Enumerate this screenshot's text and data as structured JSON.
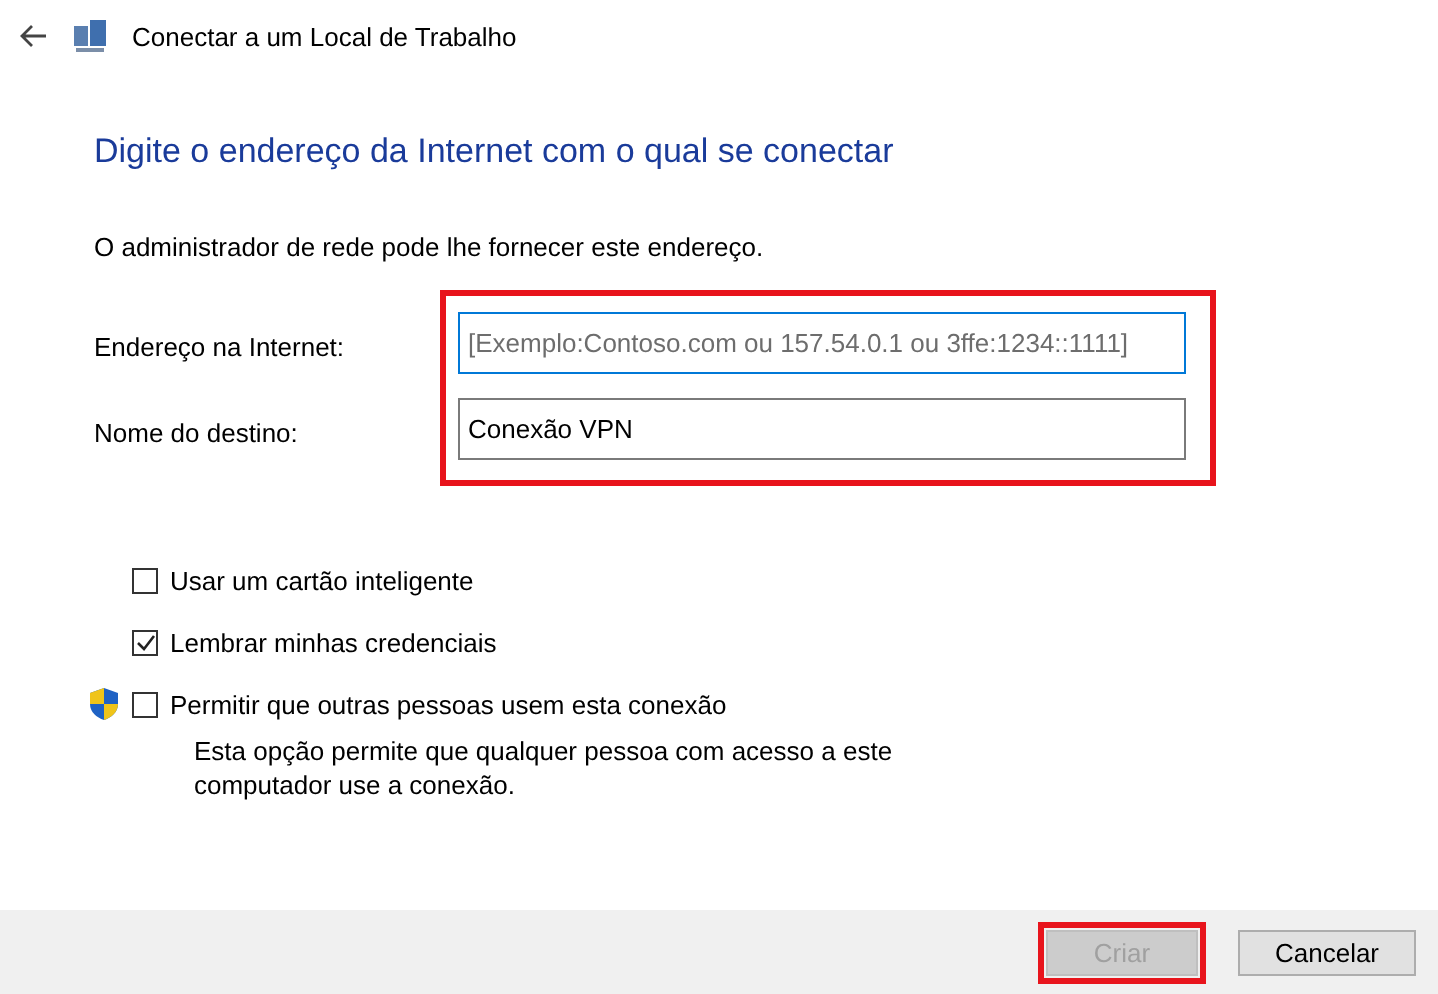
{
  "window": {
    "title": "Conectar a um Local de Trabalho"
  },
  "heading": "Digite o endereço da Internet com o qual se conectar",
  "intro": "O administrador de rede pode lhe fornecer este endereço.",
  "form": {
    "highlighted": true,
    "fields": [
      {
        "label": "Endereço na Internet:",
        "placeholder": "[Exemplo:Contoso.com ou 157.54.0.1 ou 3ffe:1234::1111]",
        "focused": true
      },
      {
        "label": "Nome do destino:",
        "value": "Conexão VPN",
        "focused": false
      }
    ]
  },
  "options": [
    {
      "label": "Usar um cartão inteligente",
      "checked": false,
      "shield": false
    },
    {
      "label": "Lembrar minhas credenciais",
      "checked": true,
      "shield": false
    },
    {
      "label": "Permitir que outras pessoas usem esta conexão",
      "checked": false,
      "shield": true,
      "description": "Esta opção permite que qualquer pessoa com acesso a este computador use a conexão."
    }
  ],
  "buttons": [
    {
      "label": "Criar",
      "disabled": true,
      "highlighted": true
    },
    {
      "label": "Cancelar",
      "disabled": false,
      "highlighted": false
    }
  ]
}
